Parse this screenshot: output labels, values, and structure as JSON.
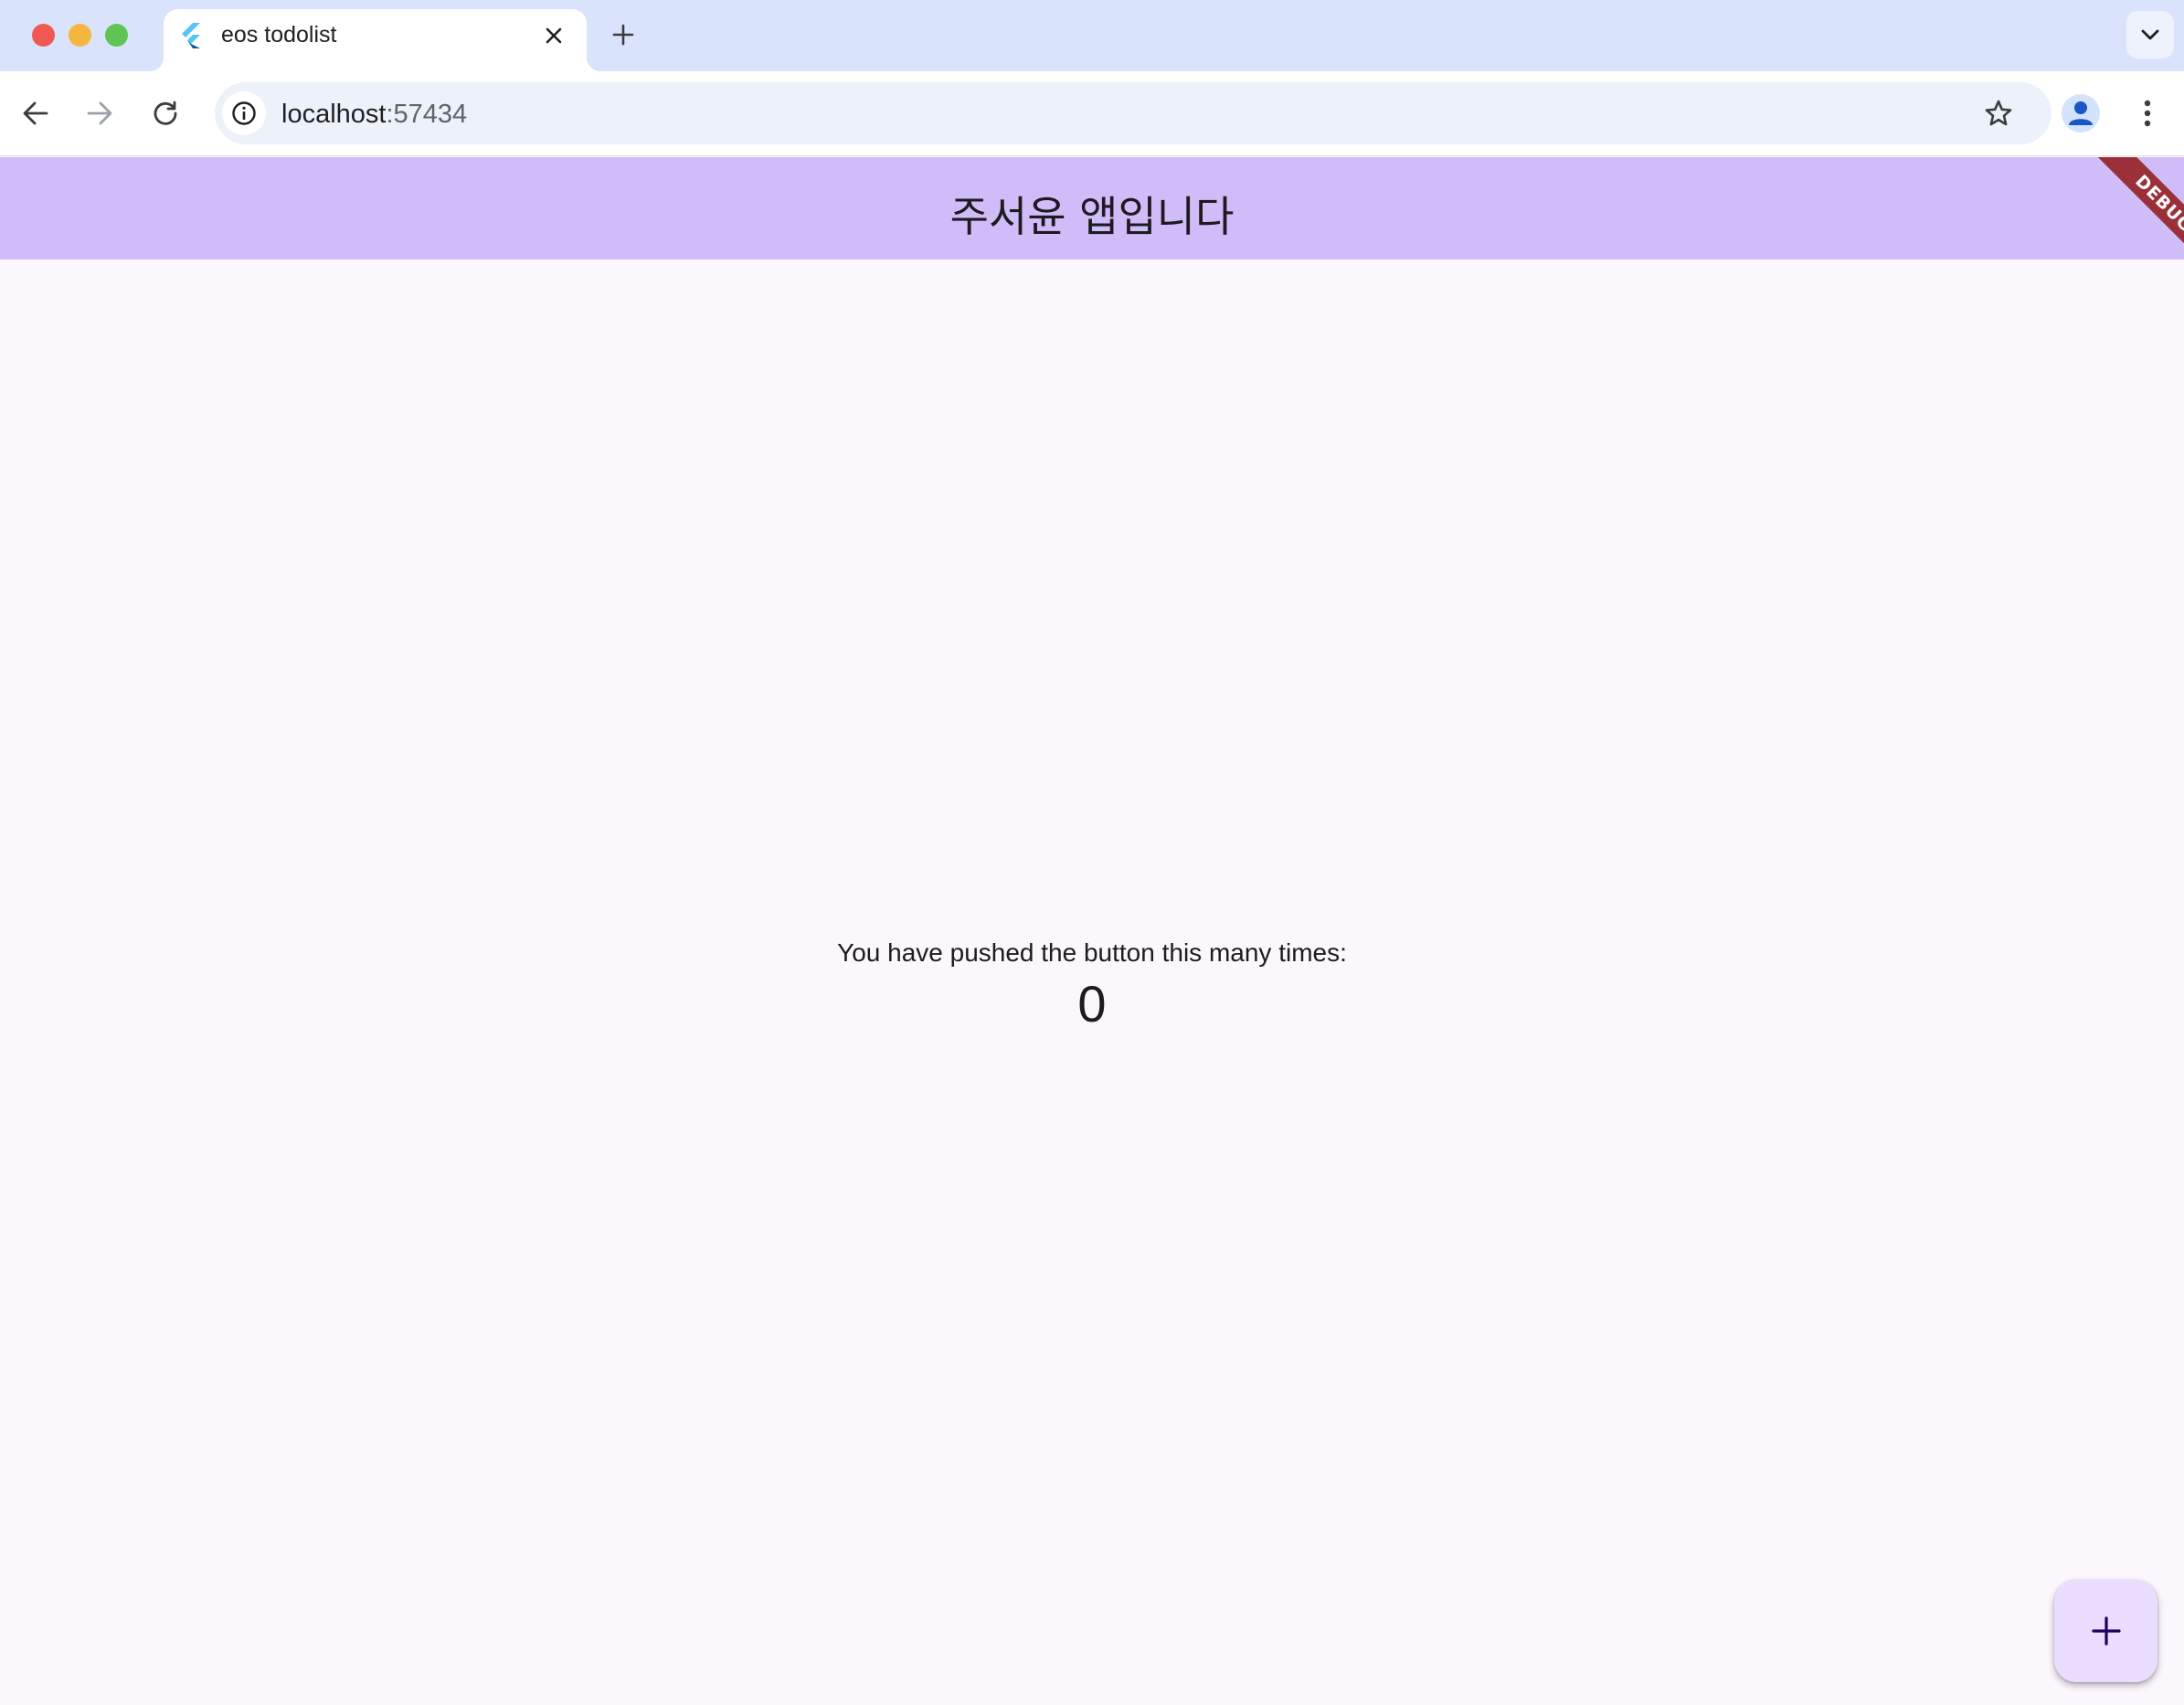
{
  "browser": {
    "tab": {
      "title": "eos todolist",
      "favicon": "flutter-logo-icon"
    },
    "new_tab_icon": "plus-icon",
    "tab_search_icon": "chevron-down-icon",
    "nav": {
      "back_icon": "arrow-left-icon",
      "forward_icon": "arrow-right-icon",
      "reload_icon": "reload-icon"
    },
    "address": {
      "host": "localhost",
      "port": ":57434",
      "site_info_icon": "info-icon",
      "bookmark_icon": "star-icon"
    },
    "profile_icon": "person-icon",
    "menu_icon": "kebab-menu-icon"
  },
  "app": {
    "title": "주서윤 앱입니다",
    "debug_banner": "DEBUG",
    "counter_caption": "You have pushed the button this many times:",
    "counter_value": "0",
    "fab_icon": "plus-icon"
  },
  "colors": {
    "tabstrip_bg": "#d9e3fb",
    "appbar_bg": "#d0bcf8",
    "content_bg": "#fcf6fd",
    "fab_bg": "#eaddff",
    "debug_banner_bg": "#9b2f3a"
  }
}
